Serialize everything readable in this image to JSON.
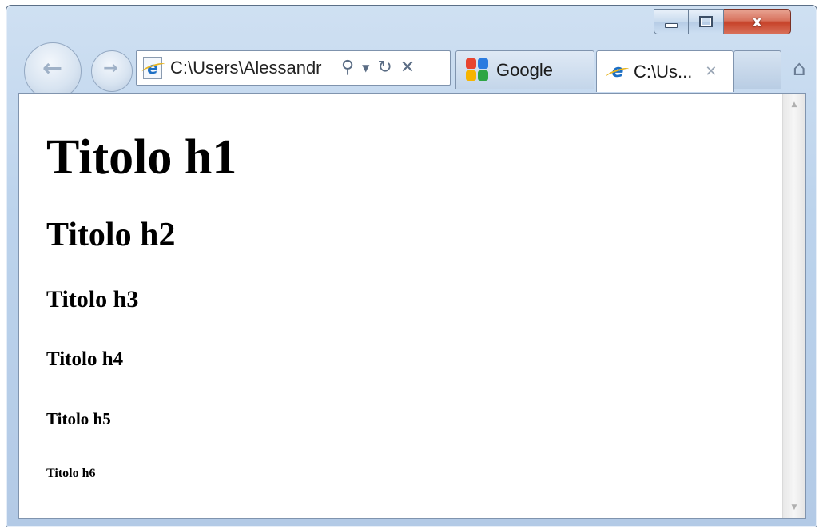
{
  "window": {
    "caption_buttons": {
      "minimize_icon": "minimize-icon",
      "maximize_icon": "maximize-icon",
      "close_glyph": "x"
    }
  },
  "nav": {
    "back_glyph": "←",
    "forward_glyph": "→"
  },
  "address_bar": {
    "url": "C:\\Users\\Alessandr",
    "search_glyph": "⚲",
    "dropdown_glyph": "▼",
    "refresh_glyph": "↻",
    "stop_glyph": "✕"
  },
  "tabs": [
    {
      "label": "Google",
      "icon": "google-icon",
      "active": false
    },
    {
      "label": "C:\\Us...",
      "icon": "ie-icon",
      "active": true,
      "close_glyph": "✕"
    }
  ],
  "home_glyph": "⌂",
  "page": {
    "h1": "Titolo h1",
    "h2": "Titolo h2",
    "h3": "Titolo h3",
    "h4": "Titolo h4",
    "h5": "Titolo h5",
    "h6": "Titolo h6"
  },
  "scrollbar": {
    "up_glyph": "▲",
    "down_glyph": "▼"
  },
  "colors": {
    "chrome": "#bcd3ec",
    "close_button": "#c7432a",
    "ie_blue": "#1d6fc4"
  }
}
